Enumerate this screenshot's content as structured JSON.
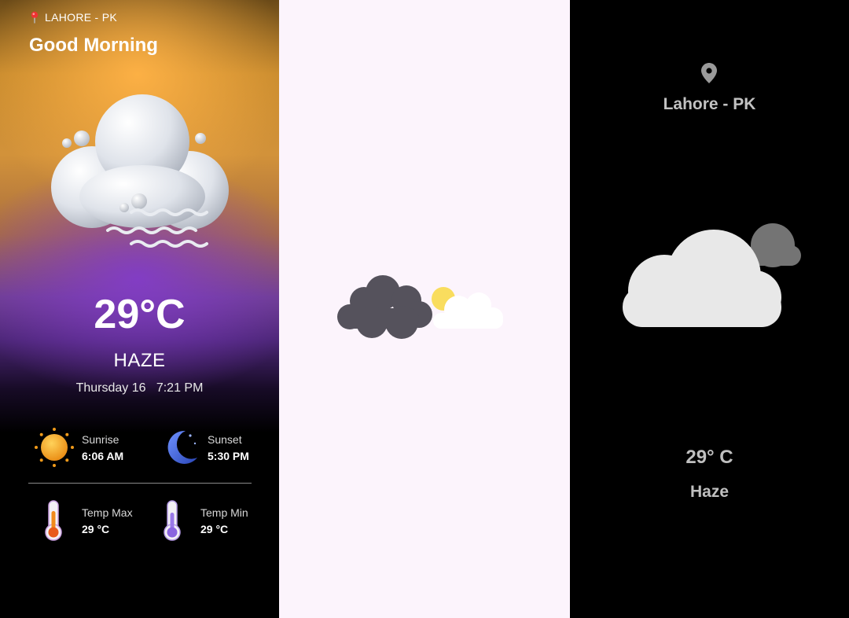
{
  "screen1": {
    "location": "LAHORE - PK",
    "greeting": "Good Morning",
    "weather_icon": "haze-cloud-icon",
    "temperature": "29°C",
    "condition": "HAZE",
    "datetime": "Thursday 16   7:21 PM",
    "sunrise": {
      "label": "Sunrise",
      "value": "6:06 AM",
      "icon": "sun-icon"
    },
    "sunset": {
      "label": "Sunset",
      "value": "5:30 PM",
      "icon": "moon-icon"
    },
    "temp_max": {
      "label": "Temp Max",
      "value": "29 °C",
      "icon": "thermometer-hot-icon"
    },
    "temp_min": {
      "label": "Temp Min",
      "value": "29 °C",
      "icon": "thermometer-cold-icon"
    }
  },
  "screen2": {
    "weather_icon": "cloudy-with-sun-icon",
    "background": "#fcf4fc"
  },
  "screen3": {
    "location_icon": "location-pin-icon",
    "location": "Lahore - PK",
    "weather_icon": "cloud-icon",
    "temperature": "29° C",
    "condition": "Haze"
  },
  "colors": {
    "screen1_accent_top": "#ffb246",
    "screen1_accent_mid": "#823cc8",
    "screen3_text": "#c2c2c2"
  }
}
